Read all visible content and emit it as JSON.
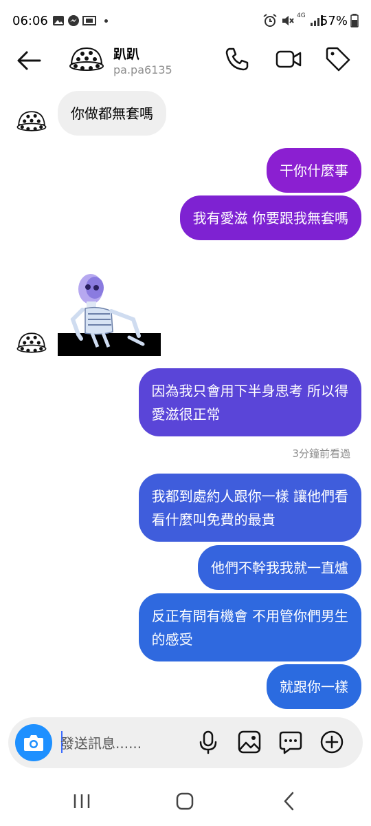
{
  "status_bar": {
    "time": "06:06",
    "battery": "57%",
    "network": "4G"
  },
  "header": {
    "name": "趴趴",
    "handle": "pa.pa6135"
  },
  "messages": [
    {
      "text": "你做都無套嗎"
    },
    {
      "text": "干你什麼事"
    },
    {
      "text": "我有愛滋 你要跟我無套嗎"
    },
    {
      "line1": "因為我只會用下半身思考 所以得",
      "line2": "愛滋很正常"
    },
    {
      "line1": "我都到處約人跟你一樣 讓他們看",
      "line2": "看什麼叫免費的最貴"
    },
    {
      "text": "他們不幹我我就一直爐"
    },
    {
      "line1": "反正有問有機會 不用管你們男生",
      "line2": "的感受"
    },
    {
      "text": "就跟你一樣"
    }
  ],
  "seen_text": "3分鐘前看過",
  "composer": {
    "placeholder": "發送訊息......"
  },
  "colors": {
    "grad_top": "#8b1fd1",
    "grad_mid": "#5a45d8",
    "grad_bottom": "#2b6be0",
    "camera": "#1e90ff"
  }
}
